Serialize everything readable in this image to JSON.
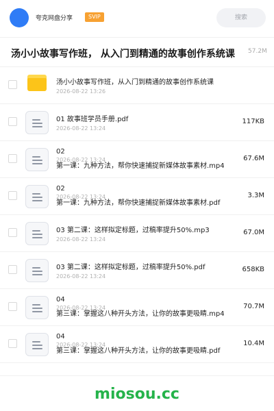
{
  "header": {
    "share_name": "夸克网盘分享",
    "badge": "SVIP",
    "search_placeholder": "搜索",
    "avatar_color": "#2f7cf6",
    "badge_color": "#f7a132"
  },
  "title_bar": {
    "title": "汤小小故事写作班， 从入门到精通的故事创作系统课",
    "total_size": "57.2M"
  },
  "files": [
    {
      "type": "folder",
      "icon": "folder-icon",
      "name": "汤小小故事写作班，从入门到精通的故事创作系统课",
      "sub": "",
      "date": "2026-08-22 13:26",
      "size": ""
    },
    {
      "type": "file",
      "icon": "document-icon",
      "name": "01 故事班学员手册.pdf",
      "sub": "",
      "date": "2026-08-22 13:24",
      "size": "117KB"
    },
    {
      "type": "file",
      "icon": "document-icon",
      "name": "02",
      "sub": "第一课：九种方法，帮你快速捕捉新媒体故事素材.mp4",
      "date": "2026-08-22 13:24",
      "size": "67.6M"
    },
    {
      "type": "file",
      "icon": "document-icon",
      "name": "02",
      "sub": "第一课：九种方法，帮你快速捕捉新媒体故事素材.pdf",
      "date": "2026-08-22 13:24",
      "size": "3.3M"
    },
    {
      "type": "file",
      "icon": "document-icon",
      "name": "03 第二课：这样拟定标题，过稿率提升50%.mp3",
      "sub": "",
      "date": "2026-08-22 13:24",
      "size": "67.0M"
    },
    {
      "type": "file",
      "icon": "document-icon",
      "name": "03 第二课：这样拟定标题，过稿率提升50%.pdf",
      "sub": "",
      "date": "2026-08-22 13:24",
      "size": "658KB"
    },
    {
      "type": "file",
      "icon": "document-icon",
      "name": "04",
      "sub": "第三课：掌握这八种开头方法，让你的故事更吸睛.mp4",
      "date": "2026-08-22 13:24",
      "size": "70.7M"
    },
    {
      "type": "file",
      "icon": "document-icon",
      "name": "04",
      "sub": "第三课：掌握这八种开头方法，让你的故事更吸睛.pdf",
      "date": "2026-08-22 13:24",
      "size": "10.4M"
    }
  ],
  "footer": {
    "watermark": "miosou.cc",
    "watermark_color": "#25b34a"
  }
}
